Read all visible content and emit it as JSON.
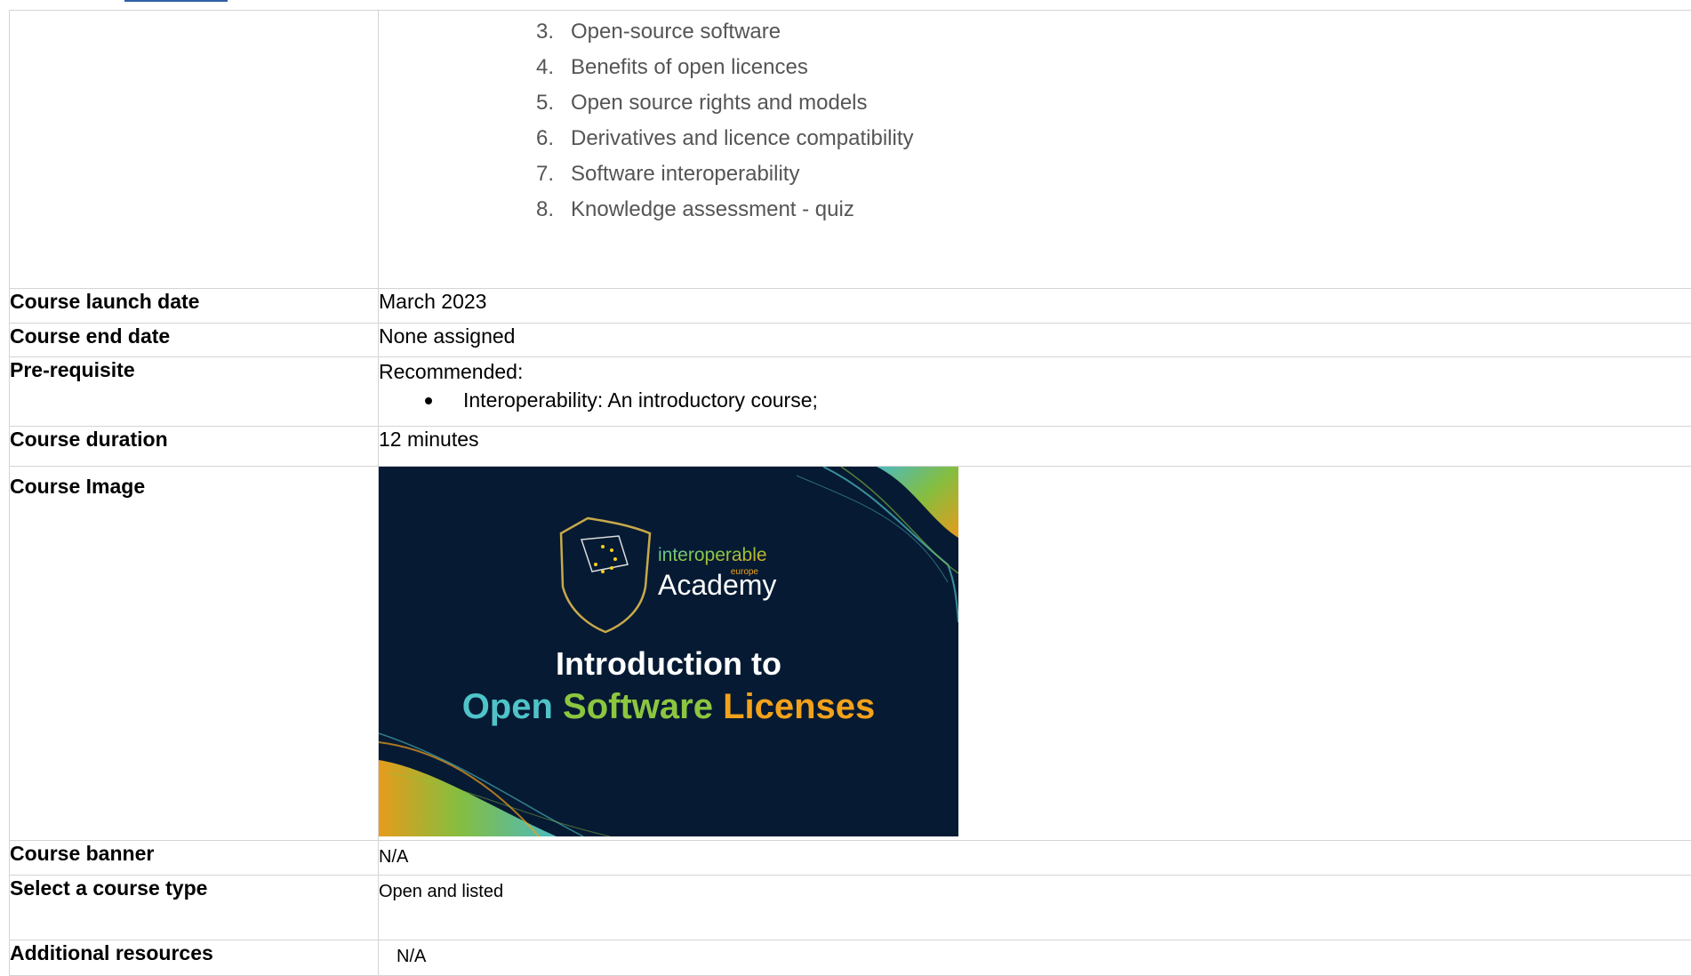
{
  "syllabus": {
    "items": [
      {
        "num": "3.",
        "text": "Open-source software"
      },
      {
        "num": "4.",
        "text": "Benefits of open licences"
      },
      {
        "num": "5.",
        "text": "Open source rights and models"
      },
      {
        "num": "6.",
        "text": "Derivatives and licence compatibility"
      },
      {
        "num": "7.",
        "text": "Software interoperability"
      },
      {
        "num": "8.",
        "text": "Knowledge assessment - quiz"
      }
    ]
  },
  "rows": {
    "launch": {
      "label": "Course launch date",
      "value": "March 2023"
    },
    "end": {
      "label": "Course end date",
      "value": "None assigned"
    },
    "prereq": {
      "label": "Pre-requisite",
      "value": "Recommended:",
      "bullets": [
        "Interoperability: An introductory course;"
      ]
    },
    "duration": {
      "label": "Course duration",
      "value": "12 minutes"
    },
    "image": {
      "label": "Course Image",
      "logo_top": "interoperable",
      "logo_sub": "europe",
      "logo_main": "Academy",
      "line1": "Introduction to",
      "line2_a": "Open",
      "line2_b": "Software",
      "line2_c": "Licenses"
    },
    "banner": {
      "label": "Course banner",
      "value": "N/A"
    },
    "type": {
      "label": "Select a course type",
      "value": "Open and listed"
    },
    "resources": {
      "label": "Additional resources",
      "value": "N/A"
    }
  },
  "colors": {
    "image_bg": "#061a33",
    "teal": "#4fc3c8",
    "green": "#8cc63f",
    "orange": "#f2a21b"
  }
}
